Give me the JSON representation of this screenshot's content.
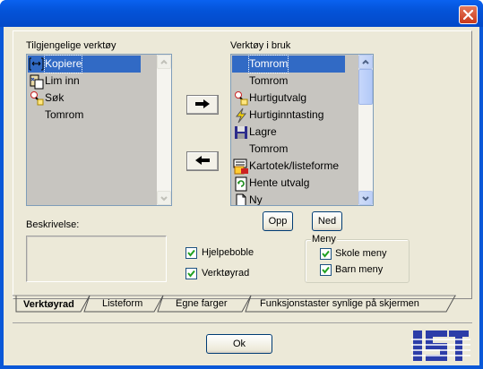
{
  "window": {
    "close_icon": "close-x-icon"
  },
  "available": {
    "label": "Tilgjengelige verktøy",
    "items": [
      {
        "label": "Kopiere",
        "icon": "copy-icon",
        "selected": true
      },
      {
        "label": "Lim inn",
        "icon": "paste-icon",
        "selected": false
      },
      {
        "label": "Søk",
        "icon": "search-icon",
        "selected": false
      },
      {
        "label": "Tomrom",
        "icon": "",
        "selected": false
      }
    ]
  },
  "in_use": {
    "label": "Verktøy i bruk",
    "items": [
      {
        "label": "Tomrom",
        "icon": "",
        "selected": true
      },
      {
        "label": "Tomrom",
        "icon": "",
        "selected": false
      },
      {
        "label": "Hurtigutvalg",
        "icon": "quick-select-icon",
        "selected": false
      },
      {
        "label": "Hurtiginntasting",
        "icon": "lightning-icon",
        "selected": false
      },
      {
        "label": "Lagre",
        "icon": "save-icon",
        "selected": false
      },
      {
        "label": "Tomrom",
        "icon": "",
        "selected": false
      },
      {
        "label": "Kartotek/listeforme",
        "icon": "card-file-icon",
        "selected": false
      },
      {
        "label": "Hente utvalg",
        "icon": "refresh-icon",
        "selected": false
      },
      {
        "label": "Ny",
        "icon": "new-document-icon",
        "selected": false
      }
    ]
  },
  "buttons": {
    "up": "Opp",
    "down": "Ned",
    "ok": "Ok",
    "add_icon": "arrow-right-icon",
    "remove_icon": "arrow-left-icon"
  },
  "description": {
    "label": "Beskrivelse:",
    "value": ""
  },
  "options": {
    "help_bubble": {
      "label": "Hjelpeboble",
      "checked": true
    },
    "toolbar": {
      "label": "Verktøyrad",
      "checked": true
    }
  },
  "menu": {
    "legend": "Meny",
    "school_menu": {
      "label": "Skole meny",
      "checked": true
    },
    "child_menu": {
      "label": "Barn meny",
      "checked": true
    }
  },
  "tabs": [
    {
      "label": "Verktøyrad",
      "active": true
    },
    {
      "label": "Listeform",
      "active": false
    },
    {
      "label": "Egne farger",
      "active": false
    },
    {
      "label": "Funksjonstaster synlige på skjermen",
      "active": false
    }
  ],
  "logo": {
    "text": "IST",
    "color": "#2c3da8"
  },
  "colors": {
    "titlebar": "#0453d8",
    "selection": "#316ac5",
    "list_bg": "#c7c5c0",
    "dialog_bg": "#ece9d8"
  }
}
